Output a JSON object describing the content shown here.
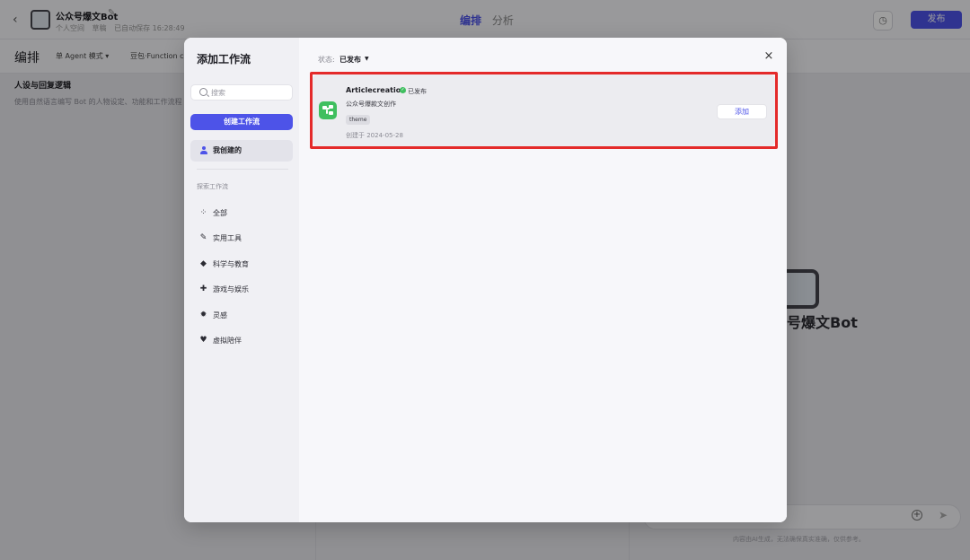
{
  "header": {
    "bot_name": "公众号爆文Bot",
    "meta": [
      "个人空间",
      "草稿",
      "已自动保存 16:28:49"
    ],
    "tabs": [
      "编排",
      "分析"
    ],
    "publish_label": "发布"
  },
  "toolbar": {
    "title": "编排",
    "mode": "单 Agent 模式",
    "model": "豆包·Function c"
  },
  "left_pane": {
    "title": "人设与回复逻辑",
    "desc": "使用自然语言编写 Bot 的人物设定、功能和工作流程"
  },
  "preview": {
    "bot_name": "号爆文Bot",
    "disclaimer": "内容由AI生成，无法确保真实准确，仅供参考。"
  },
  "modal": {
    "title": "添加工作流",
    "search_placeholder": "搜索",
    "create_label": "创建工作流",
    "mine_label": "我创建的",
    "explore_label": "探索工作流",
    "categories": [
      "全部",
      "实用工具",
      "科学与教育",
      "游戏与娱乐",
      "灵感",
      "虚拟陪伴"
    ],
    "status_label": "状态:",
    "status_value": "已发布",
    "close_icon": "×"
  },
  "workflow": {
    "name": "Articlecreation",
    "status": "已发布",
    "description": "公众号爆款文创作",
    "tag": "theme",
    "created": "创建于 2024-05-28",
    "add_label": "添加"
  },
  "colors": {
    "accent": "#4d53e8",
    "success": "#3fbf5f",
    "highlight": "#e42a2a"
  }
}
